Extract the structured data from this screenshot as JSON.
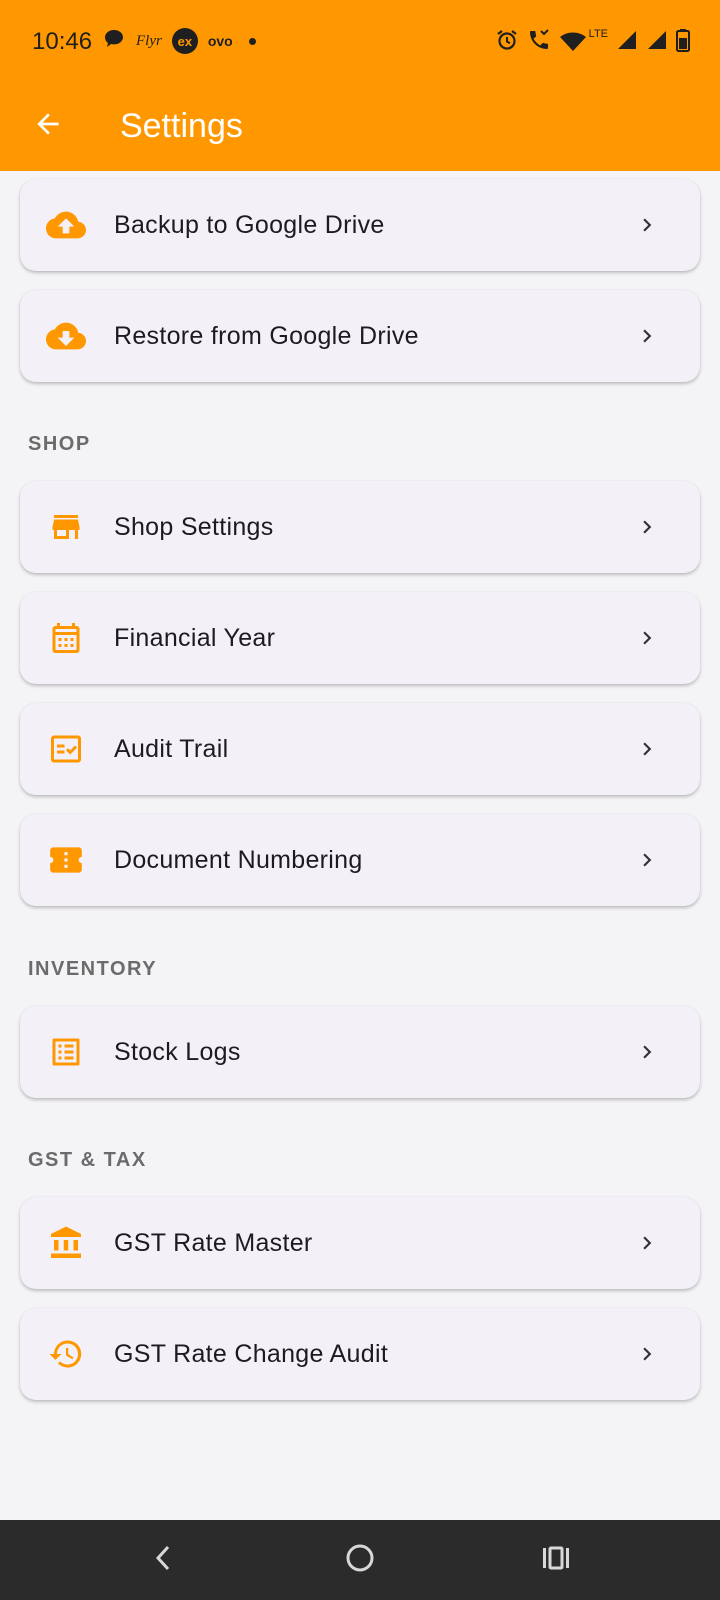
{
  "status_bar": {
    "time": "10:46",
    "left_icons": [
      "chat-bubble-icon",
      "flyr-icon",
      "ex-icon",
      "ovo-icon",
      "dot-icon"
    ],
    "flyr_text": "Flyr",
    "ex_text": "ex",
    "ovo_text": "ovo",
    "right_icons": [
      "alarm-icon",
      "wifi-call-icon",
      "wifi-icon",
      "signal-icon",
      "signal-icon",
      "battery-icon"
    ],
    "lte_text": "LTE"
  },
  "app_bar": {
    "title": "Settings",
    "back_icon": "arrow-back-icon",
    "background": "#FF9800"
  },
  "accent_color": "#FF9800",
  "backup_items": [
    {
      "label": "Backup to Google Drive",
      "icon": "cloud-upload-icon"
    },
    {
      "label": "Restore from Google Drive",
      "icon": "cloud-download-icon"
    }
  ],
  "sections": [
    {
      "header": "SHOP",
      "items": [
        {
          "label": "Shop Settings",
          "icon": "store-icon"
        },
        {
          "label": "Financial Year",
          "icon": "calendar-icon"
        },
        {
          "label": "Audit Trail",
          "icon": "fact-check-icon"
        },
        {
          "label": "Document Numbering",
          "icon": "ticket-icon"
        }
      ]
    },
    {
      "header": "INVENTORY",
      "items": [
        {
          "label": "Stock Logs",
          "icon": "list-alt-icon"
        }
      ]
    },
    {
      "header": "GST & TAX",
      "items": [
        {
          "label": "GST Rate Master",
          "icon": "bank-icon"
        },
        {
          "label": "GST Rate Change Audit",
          "icon": "history-icon"
        }
      ]
    }
  ],
  "nav_bar": {
    "buttons": [
      "nav-back-icon",
      "nav-home-icon",
      "nav-recents-icon"
    ]
  }
}
